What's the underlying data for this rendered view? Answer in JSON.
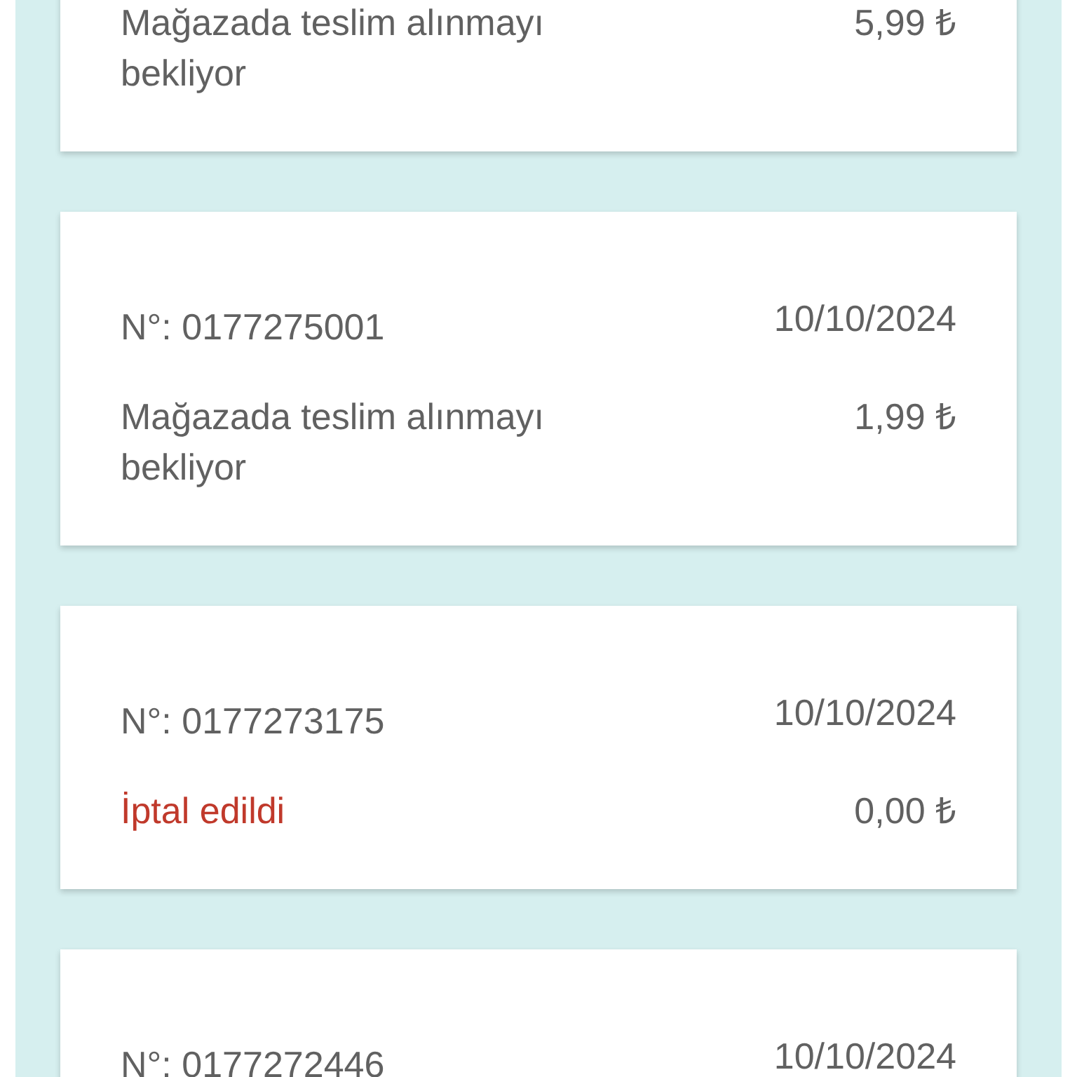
{
  "orders": [
    {
      "status": "Mağazada teslim alınmayı bekliyor",
      "kind": "pending",
      "price": "5,99 ₺"
    },
    {
      "number": "N°: 0177275001",
      "date": "10/10/2024",
      "status": "Mağazada teslim alınmayı bekliyor",
      "kind": "pending",
      "price": "1,99 ₺"
    },
    {
      "number": "N°: 0177273175",
      "date": "10/10/2024",
      "status": "İptal edildi",
      "kind": "cancelled",
      "price": "0,00 ₺"
    },
    {
      "number": "N°: 0177272446",
      "date": "10/10/2024"
    }
  ]
}
